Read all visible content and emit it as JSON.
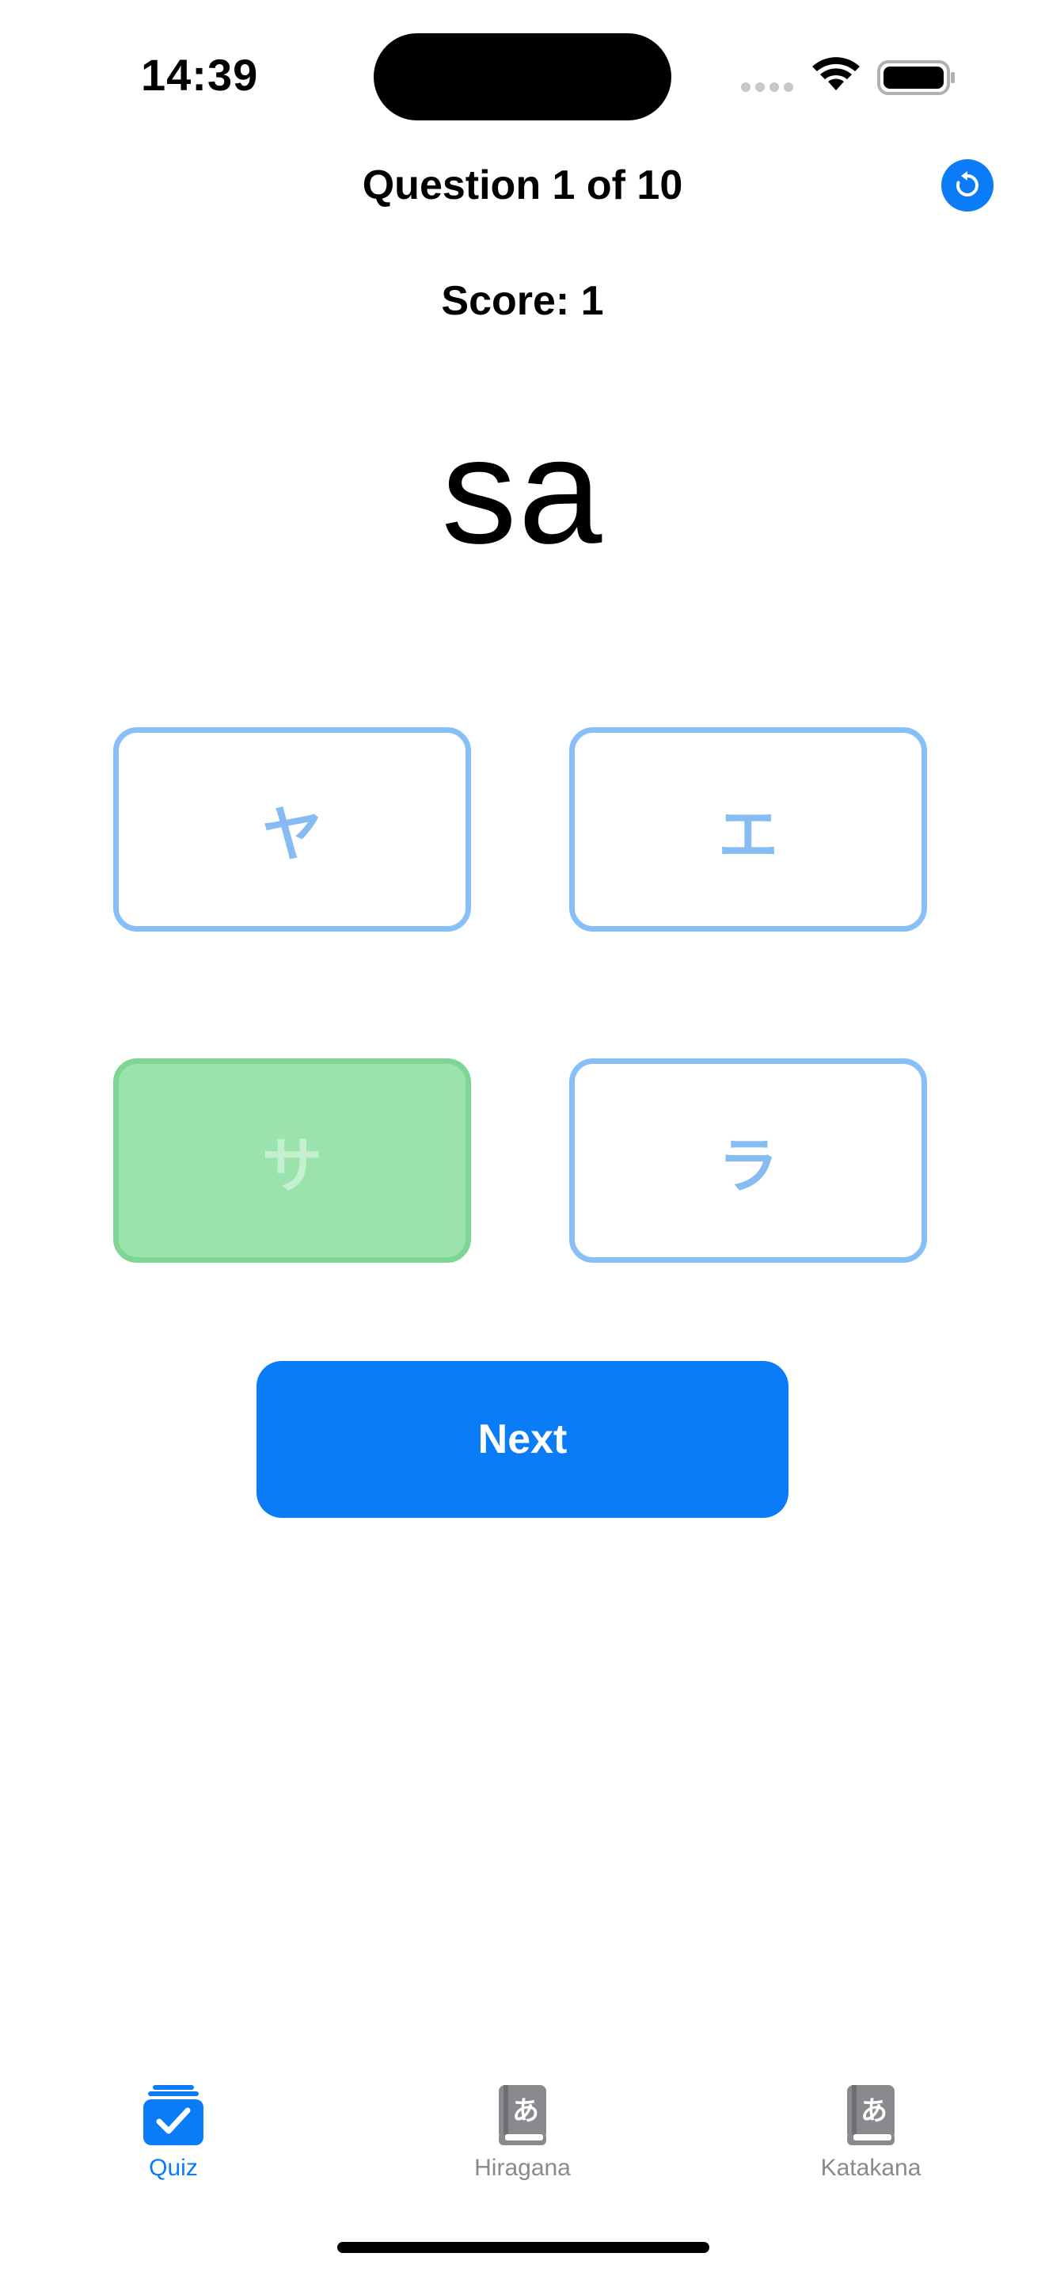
{
  "status_bar": {
    "time": "14:39"
  },
  "header": {
    "title": "Question 1 of 10",
    "reset_icon": "arrow-counterclockwise-icon"
  },
  "quiz": {
    "score": "Score: 1",
    "prompt": "sa",
    "answers": [
      {
        "label": "ヤ",
        "state": "default"
      },
      {
        "label": "エ",
        "state": "default"
      },
      {
        "label": "サ",
        "state": "correct"
      },
      {
        "label": "ラ",
        "state": "default"
      }
    ],
    "next_label": "Next"
  },
  "tab_bar": {
    "items": [
      {
        "label": "Quiz",
        "icon": "quiz-checkbox-stack-icon",
        "active": true
      },
      {
        "label": "Hiragana",
        "icon": "book-a-icon",
        "active": false
      },
      {
        "label": "Katakana",
        "icon": "book-a-icon",
        "active": false
      }
    ]
  },
  "colors": {
    "accent": "#0a7cf8",
    "answer_border": "#88bff7",
    "correct_fill": "#9ae3ad",
    "inactive_tab": "#8a8a8e"
  }
}
